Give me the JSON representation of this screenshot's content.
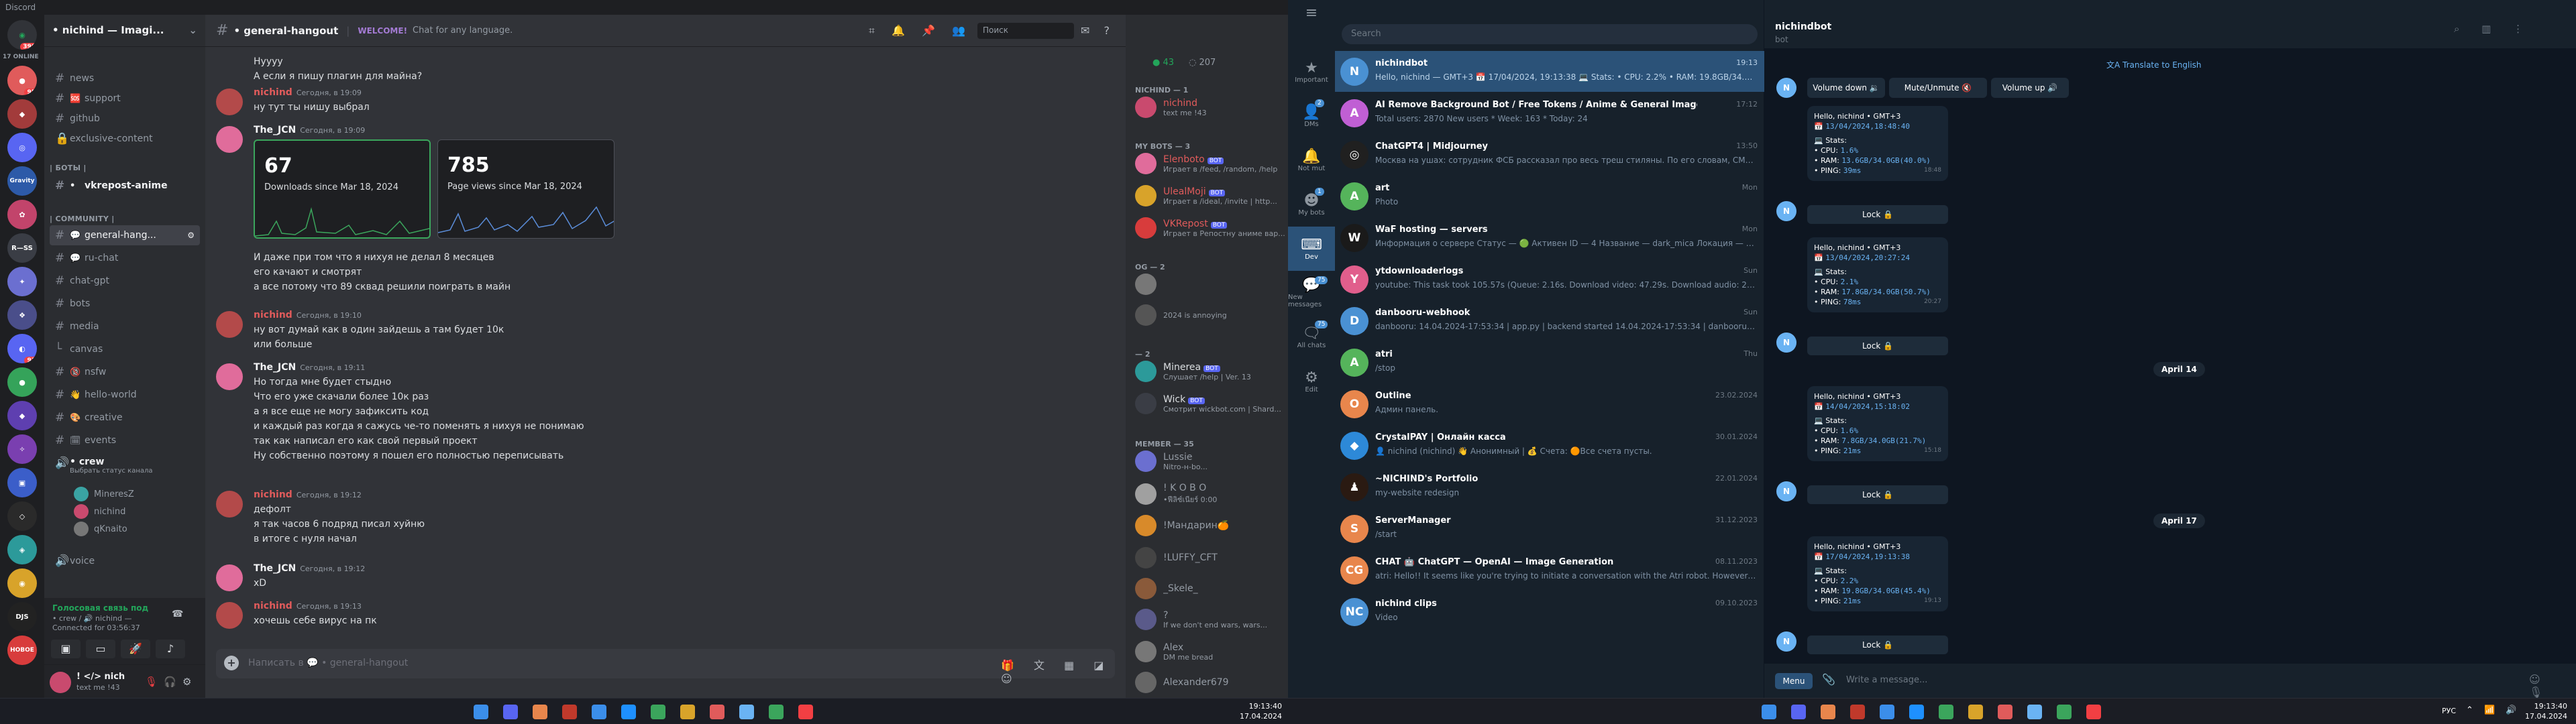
{
  "discord": {
    "title": "Discord",
    "server_name": "• nichind — Imagi...",
    "channel_header": "• general-hangout",
    "topic_badge": "WELCOME!",
    "topic": "Chat for any language.",
    "search_placeholder": "Поиск",
    "guild_online": "17 ONLINE",
    "guild_badges": [
      "396",
      "95",
      "93",
      "1",
      "3",
      "1",
      "13",
      "1"
    ],
    "guild_labels": [
      "Gravity",
      "R—SS",
      "DJS",
      "НОВОЕ"
    ],
    "channels": [
      {
        "label": "news",
        "icon": "megaphone-icon",
        "emoji": "#"
      },
      {
        "label": "support",
        "icon": "lock-icon",
        "emoji": "🆘"
      },
      {
        "label": "github",
        "icon": "hash-icon",
        "emoji": "#"
      },
      {
        "label": "exclusive-content",
        "icon": "hash-icon",
        "emoji": "🔒"
      }
    ],
    "cat_bots": "| БОТЫ |",
    "bots_channel": "vkrepost-anime",
    "cat_community": "| COMMUNITY |",
    "community_channels": [
      {
        "label": "general-hang...",
        "emoji": "💬",
        "active": true
      },
      {
        "label": "ru-chat",
        "emoji": "💬"
      },
      {
        "label": "chat-gpt",
        "emoji": "#"
      },
      {
        "label": "bots",
        "emoji": "#"
      },
      {
        "label": "media",
        "emoji": "#"
      },
      {
        "label": "canvas",
        "emoji": "#"
      },
      {
        "label": "nsfw",
        "emoji": "🔞"
      },
      {
        "label": "hello-world",
        "emoji": "👋"
      },
      {
        "label": "creative",
        "emoji": "🎨"
      },
      {
        "label": "events",
        "emoji": "🗓"
      }
    ],
    "crew_channel": "• crew",
    "crew_sub": "Выбрать статус канала",
    "voice_users": [
      "MineresZ",
      "nichind",
      "qKnaito"
    ],
    "voice_channel": "voice",
    "voice_status": "Голосовая связь под",
    "voice_route": "• crew / 🔊 nichind —",
    "voice_time": "Connected for 03:56:37",
    "user_name": "! </> nich",
    "user_status": "text me !43",
    "messages": [
      {
        "author": "",
        "time": "",
        "lines": [
          "Hyyyy",
          "А если я пишу плагин для майна?"
        ],
        "color": "#f2f3f5"
      },
      {
        "author": "nichind",
        "time": "Сегодня, в 19:09",
        "lines": [
          "ну тут ты нишу выбрал"
        ],
        "color": "#e05b5b"
      },
      {
        "author": "The_JCN",
        "time": "Сегодня, в 19:09",
        "lines": [],
        "color": "#f2f3f5"
      },
      {
        "author": "",
        "time": "",
        "lines": [
          "И даже при том что я нихуя не делал 8 месяцев",
          "его качают и смотрят",
          "а все потому что 89 сквад решили поиграть в майн"
        ],
        "color": "#f2f3f5"
      },
      {
        "author": "nichind",
        "time": "Сегодня, в 19:10",
        "lines": [
          "ну вот думай как в один зайдешь а там будет 10к",
          "или больше"
        ],
        "color": "#e05b5b"
      },
      {
        "author": "The_JCN",
        "time": "Сегодня, в 19:11",
        "lines": [
          "Но тогда мне будет стыдно",
          "Что его уже скачали более 10к раз",
          "а я все еще не могу зафиксить код",
          "и каждый раз когда я сажусь че-то поменять я нихуя не понимаю",
          "так как написал его как свой первый проект",
          "Ну собственно поэтому я пошел его полностью переписывать"
        ],
        "color": "#f2f3f5"
      },
      {
        "author": "nichind",
        "time": "Сегодня, в 19:12",
        "lines": [
          "дефолт",
          "я так часов 6 подряд писал хуйню",
          "в итоге с нуля начал"
        ],
        "color": "#e05b5b"
      },
      {
        "author": "The_JCN",
        "time": "Сегодня, в 19:12",
        "lines": [
          "xD"
        ],
        "color": "#f2f3f5"
      },
      {
        "author": "nichind",
        "time": "Сегодня, в 19:13",
        "lines": [
          "хочешь себе вирус на пк"
        ],
        "color": "#e05b5b"
      }
    ],
    "card1": {
      "value": "67",
      "label": "Downloads since Mar 18, 2024"
    },
    "card2": {
      "value": "785",
      "label": "Page views since Mar 18, 2024"
    },
    "composer_placeholder": "Написать в 💬 • general-hangout",
    "member_counts": {
      "online": "43",
      "total": "207"
    },
    "member_sections": [
      {
        "title": "NICHIND — 1",
        "members": [
          {
            "name": "nichind",
            "sub": "text me !43",
            "color": "#e05b5b"
          }
        ]
      },
      {
        "title": "MY BOTS — 3",
        "members": [
          {
            "name": "Elenboto",
            "sub": "Играет в /feed, /random, /help",
            "bot": true,
            "color": "#e05b5b"
          },
          {
            "name": "UlealMoji",
            "sub": "Играет в /ideal, /invite | http...",
            "bot": true,
            "color": "#e05b5b"
          },
          {
            "name": "VKRepost",
            "sub": "Играет в Репостну аниме вар...",
            "bot": true,
            "color": "#e05b5b"
          }
        ]
      },
      {
        "title": "OG — 2",
        "members": [
          {
            "name": "",
            "sub": "",
            "color": "#dbdee1"
          },
          {
            "name": "",
            "sub": "2024 is annoying",
            "color": "#dbdee1"
          }
        ]
      },
      {
        "title": "— 2",
        "members": [
          {
            "name": "Minerea",
            "sub": "Слушает /help | Ver. 13",
            "bot": true,
            "color": "#dbdee1"
          },
          {
            "name": "Wick",
            "sub": "Смотрит wickbot.com | Shard...",
            "bot": true,
            "color": "#dbdee1"
          }
        ]
      },
      {
        "title": "MEMBER — 35",
        "members": [
          {
            "name": "Lussie",
            "sub": "Nitro-н-bo...",
            "color": "#dbdee1"
          },
          {
            "name": "! K O B O",
            "sub": "•ฟีลิซ์เนียร์ 0:00",
            "color": "#dbdee1"
          },
          {
            "name": "!Мандарин🍊",
            "sub": "",
            "color": "#dbdee1"
          },
          {
            "name": "!LUFFY_CFT",
            "sub": "",
            "color": "#dbdee1"
          },
          {
            "name": "_Skele_",
            "sub": "",
            "color": "#dbdee1"
          },
          {
            "name": "?",
            "sub": "If we don't end wars, wars...",
            "color": "#dbdee1"
          },
          {
            "name": "Alex",
            "sub": "DM me bread",
            "color": "#dbdee1"
          },
          {
            "name": "Alexander679",
            "sub": "",
            "color": "#dbdee1"
          }
        ]
      }
    ]
  },
  "telegram": {
    "search_placeholder": "Search",
    "folders": [
      {
        "label": "Important",
        "icon": "star-icon",
        "badge": ""
      },
      {
        "label": "DMs",
        "icon": "person-icon",
        "badge": "2"
      },
      {
        "label": "Not mut",
        "icon": "bell-icon",
        "badge": ""
      },
      {
        "label": "My bots",
        "icon": "bot-icon",
        "badge": "1"
      },
      {
        "label": "Dev",
        "icon": "code-icon",
        "badge": "",
        "active": true
      },
      {
        "label": "New messages",
        "icon": "chat-icon",
        "badge": "75"
      },
      {
        "label": "All chats",
        "icon": "chats-icon",
        "badge": "75"
      },
      {
        "label": "Edit",
        "icon": "sliders-icon",
        "badge": ""
      }
    ],
    "dialogs": [
      {
        "name": "nichindbot",
        "date": "19:13",
        "preview": "Hello, nichind — GMT+3 📅 17/04/2024, 19:13:38 💻 Stats: • CPU: 2.2% • RAM: 19.8GB/34.0GB (45.4%) ...",
        "avatar": "N",
        "color": "#4a91d3",
        "selected": true
      },
      {
        "name": "AI Remove Background Bot / Free Tokens / Anime & General Image",
        "date": "17:12",
        "preview": "Total users: 2870 New users * Week: 163 * Today: 24",
        "avatar": "A",
        "color": "#c05fd4"
      },
      {
        "name": "ChatGPT4 | Midjourney",
        "date": "13:50",
        "preview": "Москва на ушах: сотрудник ФСБ рассказал про весь треш стиляны. По его словам, СМИ скрывают 90...",
        "avatar": "◎",
        "color": "#202020"
      },
      {
        "name": "art",
        "date": "Mon",
        "preview": "Photo",
        "avatar": "A",
        "color": "#55b45b"
      },
      {
        "name": "WaF hosting — servers",
        "date": "Mon",
        "preview": "Информация о сервере Статус — 🟢 Активен ID — 4 Название — dark_mica Локация — 🇩🇪 AMD R...",
        "avatar": "W",
        "color": "#1a1a1a"
      },
      {
        "name": "ytdownloaderlogs",
        "date": "Sun",
        "preview": "youtube: This task took 105.57s (Queue: 2.16s. Download video: 47.29s. Download audio: 2.81s. Combining 24.5...",
        "avatar": "Y",
        "color": "#e15e8c"
      },
      {
        "name": "danbooru-webhook",
        "date": "Sun",
        "preview": "danbooru: 14.04.2024-17:53:34 | app.py | backend started 14.04.2024-17:53:34 | danbooru.py ...",
        "avatar": "D",
        "color": "#4a91d3"
      },
      {
        "name": "atri",
        "date": "Thu",
        "preview": "/stop",
        "avatar": "A",
        "color": "#55b45b"
      },
      {
        "name": "Outline",
        "date": "23.02.2024",
        "preview": "Админ панель.",
        "avatar": "O",
        "color": "#e8864c"
      },
      {
        "name": "CrystalPAY | Онлайн касса",
        "date": "30.01.2024",
        "preview": "👤 nichind (nichind) 👋 Анонимный | 💰 Счета: 🟠Все счета пусты.",
        "avatar": "◆",
        "color": "#2d89d8"
      },
      {
        "name": "~NICHIND's Portfolio",
        "date": "22.01.2024",
        "preview": "my-website redesign",
        "avatar": "♟",
        "color": "#2a1a12"
      },
      {
        "name": "ServerManager",
        "date": "31.12.2023",
        "preview": "/start",
        "avatar": "S",
        "color": "#e8864c"
      },
      {
        "name": "CHAT 🤖 ChatGPT — OpenAI — Image Generation",
        "date": "08.11.2023",
        "preview": "atri: Hello!! It seems like you're trying to initiate a conversation with the Atri robot. However, I'm an AI language...",
        "avatar": "CG",
        "color": "#e8864c"
      },
      {
        "name": "nichind clips",
        "date": "09.10.2023",
        "preview": "Video",
        "avatar": "NC",
        "color": "#4a91d3"
      }
    ],
    "chat_title": "nichindbot",
    "chat_subtitle": "bot",
    "translate_label": "Translate to English",
    "keyboard": [
      "Volume down 🔉",
      "Mute/Unmute 🔇",
      "Volume up 🔊"
    ],
    "stat_messages": [
      {
        "hello": "Hello, nichind • GMT+3",
        "date": "13/04/2024,18:48:40",
        "cpu": "1.6%",
        "ram": "13.6GB/34.0GB(40.0%)",
        "ping": "39ms",
        "time": "18:48"
      },
      {
        "hello": "Hello, nichind • GMT+3",
        "date": "13/04/2024,20:27:24",
        "cpu": "2.1%",
        "ram": "17.8GB/34.0GB(50.7%)",
        "ping": "78ms",
        "time": "20:27"
      },
      {
        "hello": "Hello, nichind • GMT+3",
        "date": "14/04/2024,15:18:02",
        "cpu": "1.6%",
        "ram": "7.8GB/34.0GB(21.7%)",
        "ping": "21ms",
        "time": "15:18"
      },
      {
        "hello": "Hello, nichind • GMT+3",
        "date": "17/04/2024,19:13:38",
        "cpu": "2.2%",
        "ram": "19.8GB/34.0GB(45.4%)",
        "ping": "21ms",
        "time": "19:13"
      }
    ],
    "stats_label": "💻 Stats:",
    "lock_label": "Lock 🔒",
    "date_pills": [
      "April 14",
      "April 17"
    ],
    "menu_label": "Menu",
    "input_placeholder": "Write a message..."
  },
  "taskbar": {
    "left_time": "19:13:40",
    "left_date": "17.04.2024",
    "right_time": "19:13:40",
    "right_date": "17.04.2024",
    "lang": "РУС"
  }
}
